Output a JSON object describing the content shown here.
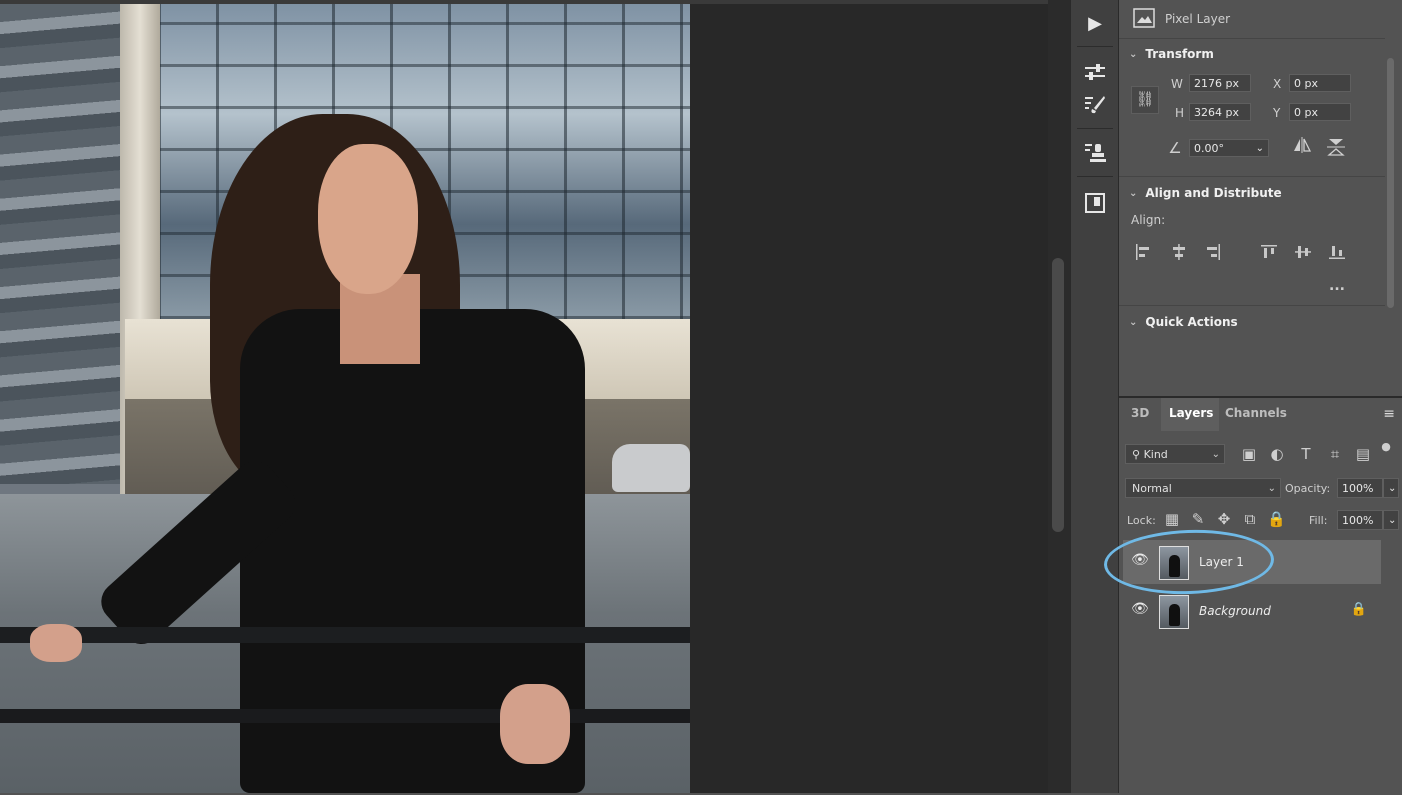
{
  "properties": {
    "layer_type": "Pixel Layer",
    "transform": {
      "title": "Transform",
      "w_label": "W",
      "w_value": "2176 px",
      "h_label": "H",
      "h_value": "3264 px",
      "x_label": "X",
      "x_value": "0 px",
      "y_label": "Y",
      "y_value": "0 px",
      "angle_value": "0.00°"
    },
    "align": {
      "title": "Align and Distribute",
      "align_label": "Align:",
      "more": "..."
    },
    "quick_actions": {
      "title": "Quick Actions"
    }
  },
  "layers_panel": {
    "tabs": [
      "3D",
      "Layers",
      "Channels"
    ],
    "active_tab": "Layers",
    "filter": {
      "value": "Kind"
    },
    "blend_mode": "Normal",
    "opacity_label": "Opacity:",
    "opacity_value": "100%",
    "lock_label": "Lock:",
    "fill_label": "Fill:",
    "fill_value": "100%",
    "layers": [
      {
        "name": "Layer 1",
        "visible": true,
        "selected": true,
        "locked": false
      },
      {
        "name": "Background",
        "visible": true,
        "selected": false,
        "locked": true
      }
    ]
  },
  "icons": {
    "play": "play-icon",
    "adjustments": "adjustments-icon",
    "brush_settings": "brush-settings-icon",
    "clone_source": "clone-source-icon",
    "properties": "properties-icon"
  },
  "colors": {
    "annotation": "#6fb9e6",
    "panel_bg": "#535353",
    "canvas_bg": "#282828"
  }
}
